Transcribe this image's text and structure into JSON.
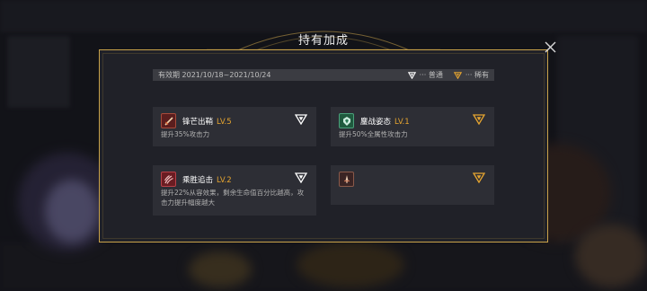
{
  "dialog": {
    "title": "持有加成",
    "close_icon": "close-icon"
  },
  "validity": {
    "period": "有效期 2021/10/18~2021/10/24",
    "legend": [
      {
        "label": "··· 普通",
        "icon": "triangle-white-icon",
        "color": "#ffffff"
      },
      {
        "label": "··· 稀有",
        "icon": "triangle-gold-icon",
        "color": "#e6a530"
      }
    ]
  },
  "cards": [
    {
      "name": "锋芒出鞘",
      "level": "LV.5",
      "desc": "提升35%攻击力",
      "icon": "sword-icon",
      "rarity": "普通"
    },
    {
      "name": "鏖战姿态",
      "level": "LV.1",
      "desc": "提升50%全属性攻击力",
      "icon": "shield-emblem-icon",
      "rarity": "稀有"
    },
    {
      "name": "乘胜追击",
      "level": "LV.2",
      "desc": "提升22%从容效果，剩余生命值百分比越高，攻击力提升幅度越大",
      "icon": "claw-icon",
      "rarity": "普通"
    },
    {
      "name": "",
      "level": "",
      "desc": "",
      "icon": "dagger-icon",
      "rarity": "稀有"
    }
  ],
  "colors": {
    "accent_gold": "#e6a530",
    "frame_gold": "#c9a24a",
    "panel_bg": "#202128",
    "card_bg": "#2d2e35"
  }
}
